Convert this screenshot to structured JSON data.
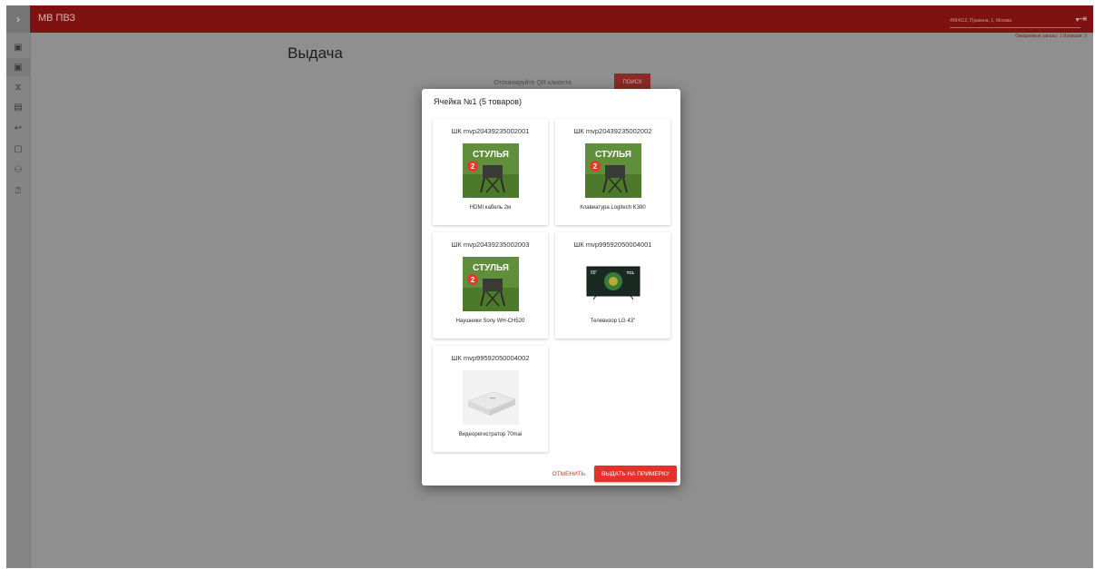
{
  "header": {
    "toggle_icon": "chevron-right-icon",
    "app_title": "МВ ПВЗ",
    "location": "4584112, Пушкина, 1, Москва",
    "logout_icon": "logout-icon",
    "status": "Ожидаемые заказы: 1   Излишки: 2"
  },
  "sidebar": {
    "items": [
      {
        "icon": "inbox-icon",
        "glyph": "▣"
      },
      {
        "icon": "inbox-out-icon",
        "glyph": "▣"
      },
      {
        "icon": "hourglass-icon",
        "glyph": "⧖"
      },
      {
        "icon": "document-icon",
        "glyph": "▤"
      },
      {
        "icon": "return-icon",
        "glyph": "↩"
      },
      {
        "icon": "chat-icon",
        "glyph": "▢"
      },
      {
        "icon": "users-icon",
        "glyph": "⚇"
      },
      {
        "icon": "help-icon",
        "glyph": "⍰"
      }
    ]
  },
  "main": {
    "title": "Выдача",
    "qr_placeholder": "Отсканируйте QR клиента",
    "search_label": "ПОИСК"
  },
  "modal": {
    "title": "Ячейка №1 (5 товаров)",
    "items": [
      {
        "barcode": "ШК mvp20439235002001",
        "name": "HDMI кабель 2м",
        "image": "chairs",
        "image_text": "СТУЛЬЯ"
      },
      {
        "barcode": "ШК mvp20439235002002",
        "name": "Клавиатура Logitech K380",
        "image": "chairs",
        "image_text": "СТУЛЬЯ"
      },
      {
        "barcode": "ШК mvp20439235002003",
        "name": "Наушники Sony WH-CH520",
        "image": "chairs",
        "image_text": "СТУЛЬЯ"
      },
      {
        "barcode": "ШК mvp99592050004001",
        "name": "Телевизор LG 43\"",
        "image": "tv",
        "image_text": "TCL"
      },
      {
        "barcode": "ШК mvp99592050004002",
        "name": "Видеорегистратор 70mai",
        "image": "dashcam",
        "image_text": ""
      }
    ],
    "cancel_label": "ОТМЕНИТЬ",
    "confirm_label": "ВЫДАТЬ НА ПРИМЕРКУ"
  },
  "colors": {
    "header_bg": "#7d1210",
    "overlay_bg": "#8f8f8f",
    "accent_red": "#e4322b"
  }
}
